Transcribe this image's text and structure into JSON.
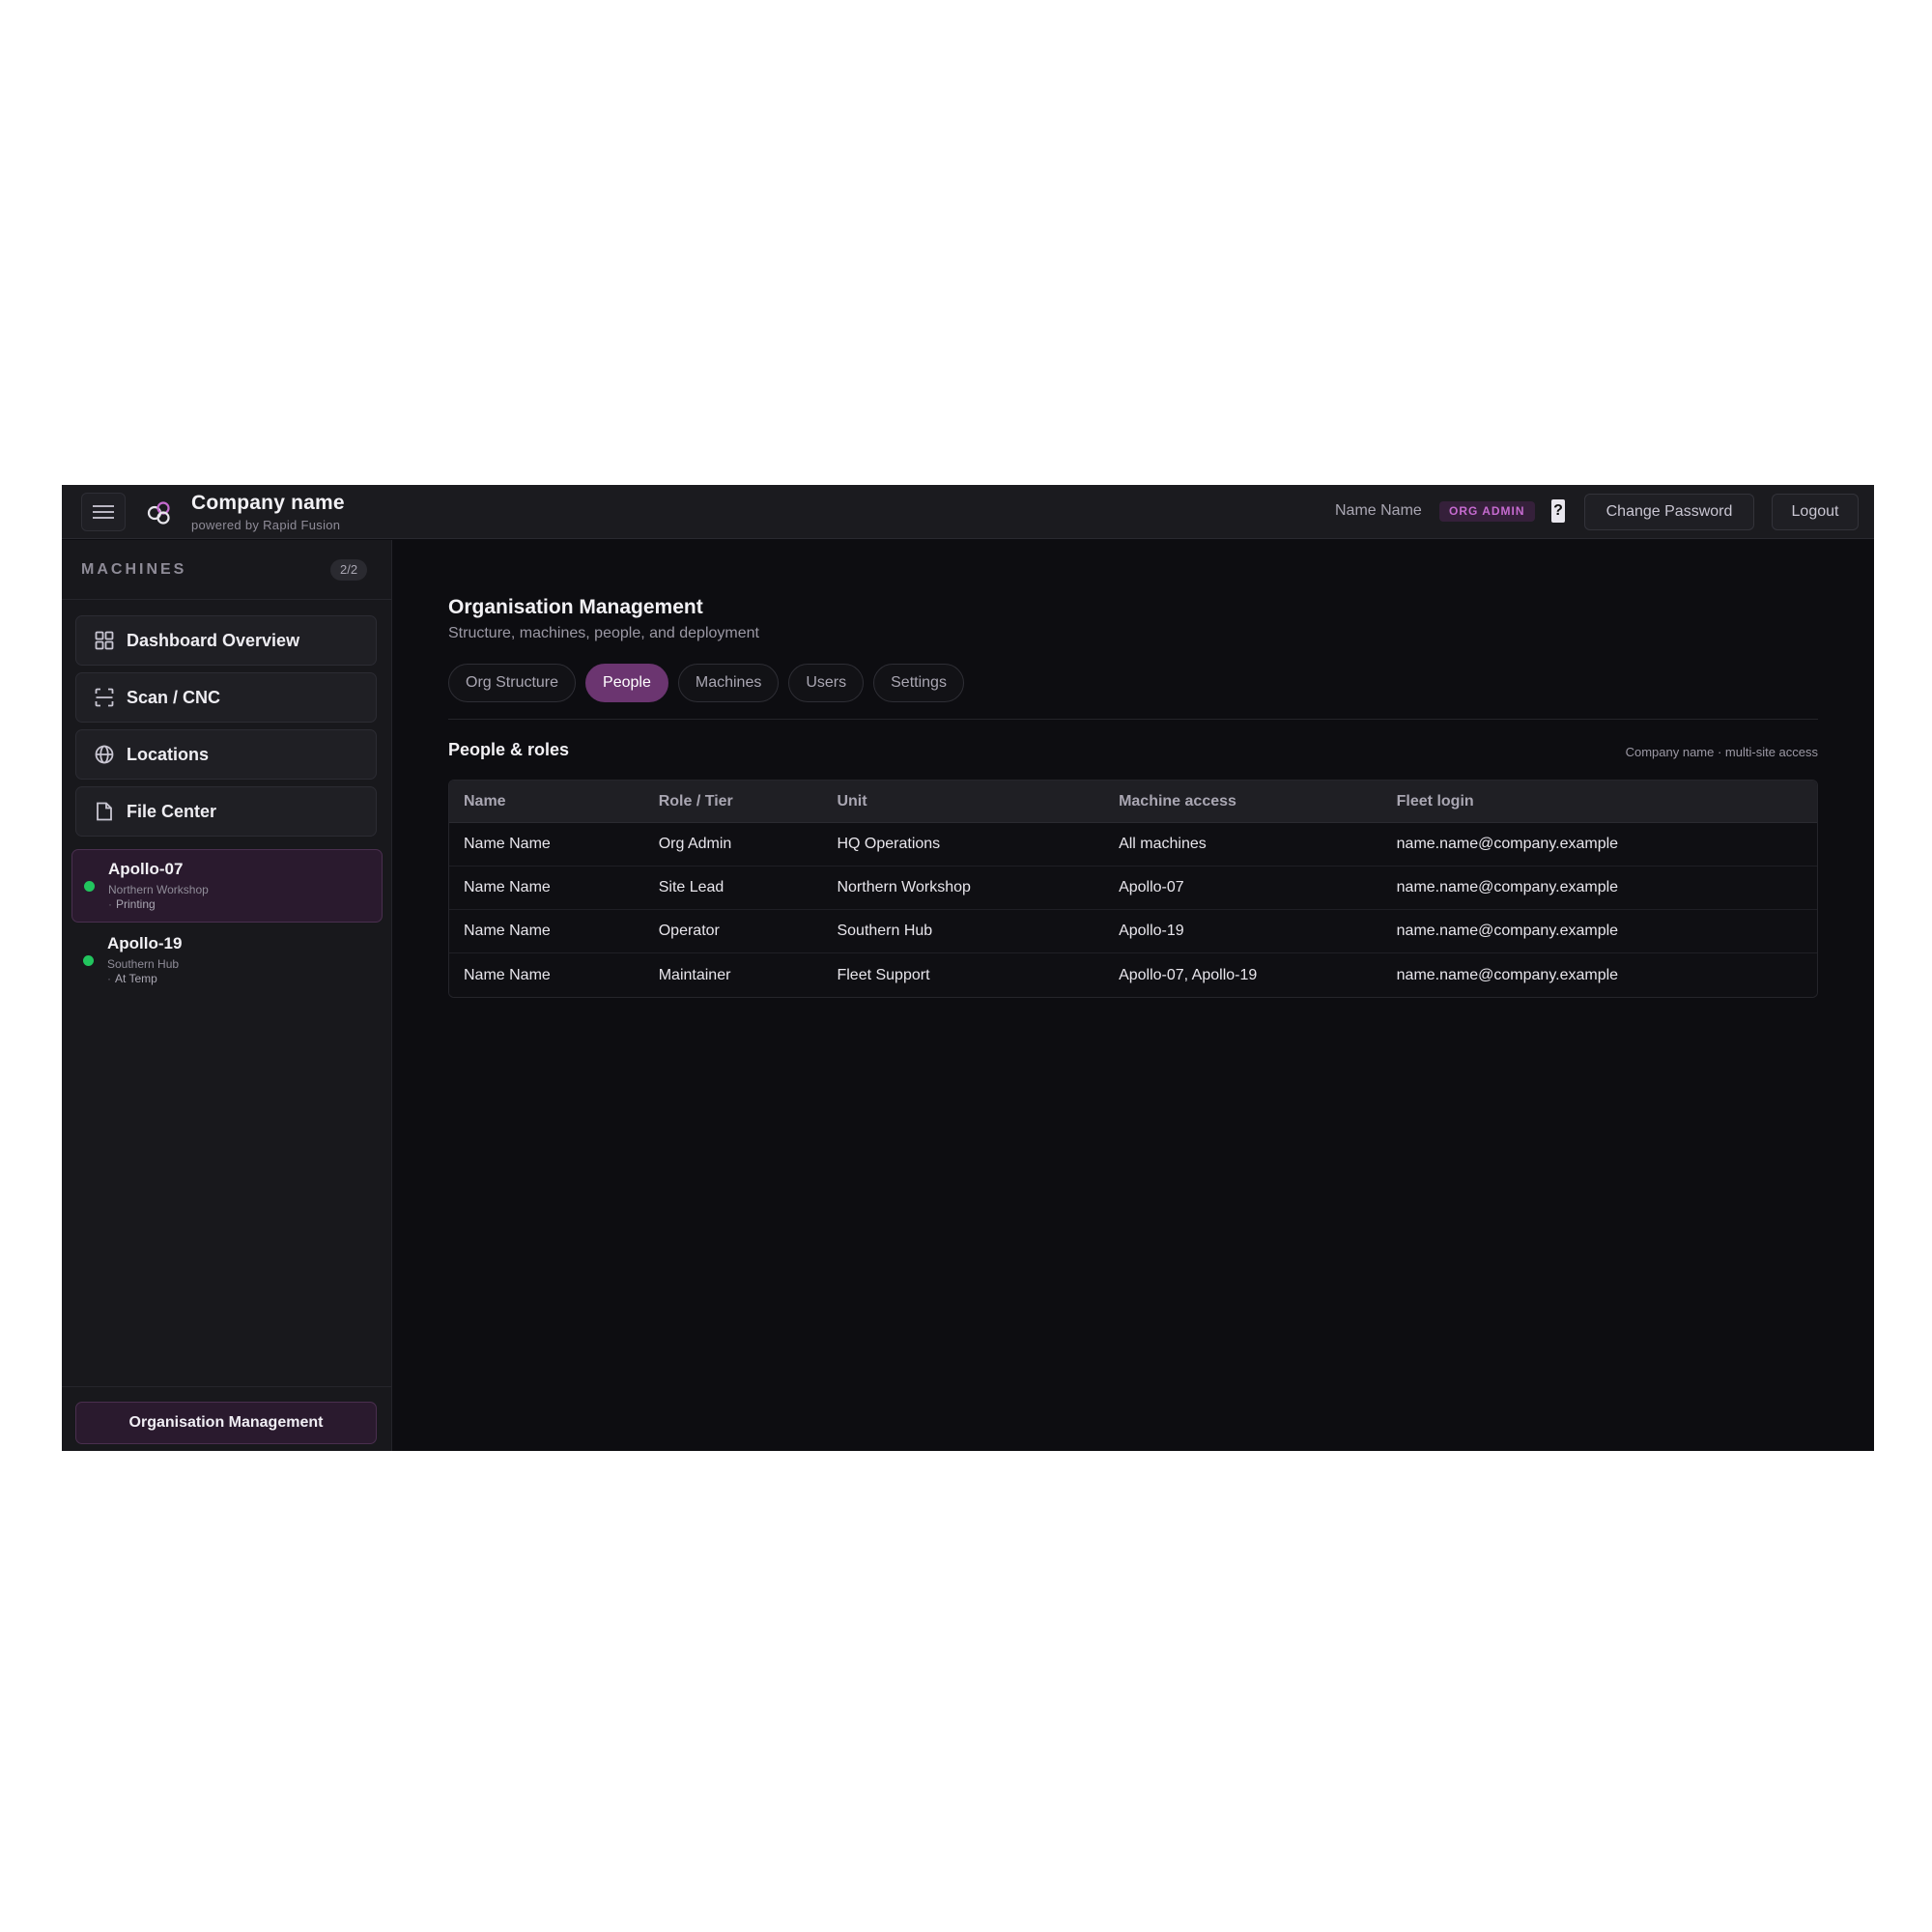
{
  "header": {
    "brand_name": "Company name",
    "brand_sub": "powered by Rapid Fusion",
    "user_name": "Name Name",
    "role_badge": "ORG ADMIN",
    "help_label": "?",
    "change_password_label": "Change Password",
    "logout_label": "Logout"
  },
  "sidebar": {
    "title": "MACHINES",
    "count": "2/2",
    "nav": [
      {
        "label": "Dashboard Overview",
        "icon": "grid-icon"
      },
      {
        "label": "Scan / CNC",
        "icon": "scan-icon"
      },
      {
        "label": "Locations",
        "icon": "globe-icon"
      },
      {
        "label": "File Center",
        "icon": "file-icon"
      }
    ],
    "machines": [
      {
        "name": "Apollo-07",
        "location": "Northern Workshop",
        "status": "Printing",
        "status_color": "#22c55e"
      },
      {
        "name": "Apollo-19",
        "location": "Southern Hub",
        "status": "At Temp",
        "status_color": "#22c55e"
      }
    ],
    "footer_button": "Organisation Management"
  },
  "main": {
    "title": "Organisation Management",
    "subtitle": "Structure, machines, people, and deployment",
    "tabs": [
      {
        "label": "Org Structure",
        "active": false
      },
      {
        "label": "People",
        "active": true
      },
      {
        "label": "Machines",
        "active": false
      },
      {
        "label": "Users",
        "active": false
      },
      {
        "label": "Settings",
        "active": false
      }
    ],
    "section_title": "People & roles",
    "section_meta": "Company name · multi-site access",
    "table": {
      "columns": [
        "Name",
        "Role / Tier",
        "Unit",
        "Machine access",
        "Fleet login"
      ],
      "rows": [
        [
          "Name Name",
          "Org Admin",
          "HQ Operations",
          "All machines",
          "name.name@company.example"
        ],
        [
          "Name Name",
          "Site Lead",
          "Northern Workshop",
          "Apollo-07",
          "name.name@company.example"
        ],
        [
          "Name Name",
          "Operator",
          "Southern Hub",
          "Apollo-19",
          "name.name@company.example"
        ],
        [
          "Name Name",
          "Maintainer",
          "Fleet Support",
          "Apollo-07, Apollo-19",
          "name.name@company.example"
        ]
      ]
    }
  },
  "colors": {
    "accent": "#6b3570",
    "badge_text": "#c66bd0",
    "online": "#22c55e",
    "background": "#0d0d11"
  }
}
